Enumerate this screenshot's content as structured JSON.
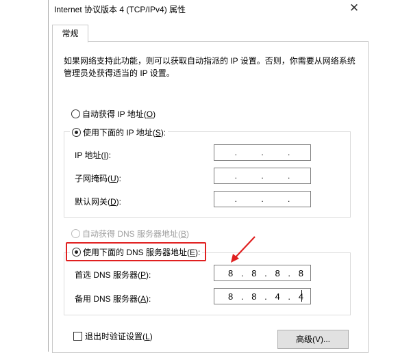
{
  "window": {
    "title": "Internet 协议版本 4 (TCP/IPv4) 属性",
    "close_glyph": "✕"
  },
  "tabs": [
    {
      "label": "常规"
    }
  ],
  "description": "如果网络支持此功能，则可以获取自动指派的 IP 设置。否则，你需要从网络系统管理员处获得适当的 IP 设置。",
  "ip_section": {
    "auto_option": {
      "pre": "自动获得 IP 地址(",
      "key": "O",
      "post": ")",
      "checked": false
    },
    "manual_option": {
      "pre": "使用下面的 IP 地址(",
      "key": "S",
      "post": "):",
      "checked": true
    },
    "fields": [
      {
        "pre": "IP 地址(",
        "key": "I",
        "post": "):",
        "value": [
          "",
          "",
          "",
          ""
        ]
      },
      {
        "pre": "子网掩码(",
        "key": "U",
        "post": "):",
        "value": [
          "",
          "",
          "",
          ""
        ]
      },
      {
        "pre": "默认网关(",
        "key": "D",
        "post": "):",
        "value": [
          "",
          "",
          "",
          ""
        ]
      }
    ],
    "separator": "."
  },
  "dns_section": {
    "auto_option": {
      "pre": "自动获得 DNS 服务器地址(",
      "key": "B",
      "post": ")",
      "checked": false,
      "disabled": true
    },
    "manual_option": {
      "pre": "使用下面的 DNS 服务器地址(",
      "key": "E",
      "post": "):",
      "checked": true
    },
    "fields": [
      {
        "pre": "首选 DNS 服务器(",
        "key": "P",
        "post": "):",
        "value": [
          "8",
          "8",
          "8",
          "8"
        ]
      },
      {
        "pre": "备用 DNS 服务器(",
        "key": "A",
        "post": "):",
        "value": [
          "8",
          "8",
          "4",
          "4"
        ]
      }
    ]
  },
  "validate_checkbox": {
    "pre": "退出时验证设置(",
    "key": "L",
    "post": ")",
    "checked": false
  },
  "advanced_button": {
    "label": "高级(V)..."
  },
  "annotation": {
    "highlight_color": "#e02020"
  }
}
